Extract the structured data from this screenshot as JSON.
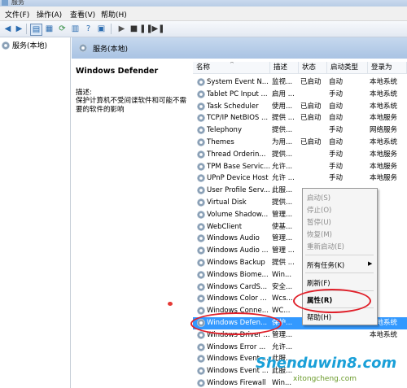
{
  "window": {
    "title": "服务"
  },
  "menu": [
    "文件(F)",
    "操作(A)",
    "查看(V)",
    "帮助(H)"
  ],
  "tree": {
    "root": "服务(本地)"
  },
  "band": {
    "label": "服务(本地)"
  },
  "detail": {
    "service_name": "Windows Defender",
    "desc_label": "描述:",
    "desc_text": "保护计算机不受间谍软件和可能不需要的软件的影响"
  },
  "columns": [
    "名称",
    "描述",
    "状态",
    "启动类型",
    "登录为"
  ],
  "rows": [
    {
      "name": "System Event N...",
      "desc": "监视...",
      "status": "已启动",
      "startup": "自动",
      "logon": "本地系统"
    },
    {
      "name": "Tablet PC Input ...",
      "desc": "启用 ...",
      "status": "",
      "startup": "手动",
      "logon": "本地系统"
    },
    {
      "name": "Task Scheduler",
      "desc": "使用...",
      "status": "已启动",
      "startup": "自动",
      "logon": "本地系统"
    },
    {
      "name": "TCP/IP NetBIOS ...",
      "desc": "提供 ...",
      "status": "已启动",
      "startup": "自动",
      "logon": "本地服务"
    },
    {
      "name": "Telephony",
      "desc": "提供...",
      "status": "",
      "startup": "手动",
      "logon": "网络服务"
    },
    {
      "name": "Themes",
      "desc": "为用...",
      "status": "已启动",
      "startup": "自动",
      "logon": "本地系统"
    },
    {
      "name": "Thread Orderin...",
      "desc": "提供...",
      "status": "",
      "startup": "手动",
      "logon": "本地服务"
    },
    {
      "name": "TPM Base Servic...",
      "desc": "允许...",
      "status": "",
      "startup": "手动",
      "logon": "本地服务"
    },
    {
      "name": "UPnP Device Host",
      "desc": "允许 ...",
      "status": "",
      "startup": "手动",
      "logon": "本地服务"
    },
    {
      "name": "User Profile Serv...",
      "desc": "此服...",
      "status": "",
      "startup": "",
      "logon": ""
    },
    {
      "name": "Virtual Disk",
      "desc": "提供...",
      "status": "",
      "startup": "",
      "logon": ""
    },
    {
      "name": "Volume Shadow...",
      "desc": "管理...",
      "status": "",
      "startup": "",
      "logon": ""
    },
    {
      "name": "WebClient",
      "desc": "使基...",
      "status": "",
      "startup": "",
      "logon": ""
    },
    {
      "name": "Windows Audio",
      "desc": "管理...",
      "status": "",
      "startup": "",
      "logon": ""
    },
    {
      "name": "Windows Audio ...",
      "desc": "管理 ...",
      "status": "",
      "startup": "",
      "logon": ""
    },
    {
      "name": "Windows Backup",
      "desc": "提供 ...",
      "status": "",
      "startup": "",
      "logon": ""
    },
    {
      "name": "Windows Biome...",
      "desc": "Win...",
      "status": "",
      "startup": "",
      "logon": ""
    },
    {
      "name": "Windows CardS...",
      "desc": "安全...",
      "status": "",
      "startup": "",
      "logon": ""
    },
    {
      "name": "Windows Color ...",
      "desc": "Wcs...",
      "status": "",
      "startup": "",
      "logon": ""
    },
    {
      "name": "Windows Conne...",
      "desc": "WC...",
      "status": "",
      "startup": "",
      "logon": ""
    },
    {
      "name": "Windows Defen...",
      "desc": "保护...",
      "status": "",
      "startup": "",
      "logon": "本地系统"
    },
    {
      "name": "Windows Driver ...",
      "desc": "管理...",
      "status": "",
      "startup": "",
      "logon": "本地系统"
    },
    {
      "name": "Windows Error ...",
      "desc": "允许...",
      "status": "",
      "startup": "",
      "logon": ""
    },
    {
      "name": "Windows Event ...",
      "desc": "此服...",
      "status": "",
      "startup": "",
      "logon": ""
    },
    {
      "name": "Windows Event ...",
      "desc": "此服...",
      "status": "",
      "startup": "",
      "logon": ""
    },
    {
      "name": "Windows Firewall",
      "desc": "Win...",
      "status": "",
      "startup": "",
      "logon": ""
    }
  ],
  "context_menu": {
    "start": "启动(S)",
    "stop": "停止(O)",
    "pause": "暂停(U)",
    "resume": "恢复(M)",
    "restart": "重新启动(E)",
    "all_tasks": "所有任务(K)",
    "refresh": "刷新(F)",
    "properties": "属性(R)",
    "help": "帮助(H)"
  },
  "watermark": {
    "line1": "Shenduwin8.com",
    "line2": "xitongcheng.com"
  },
  "colors": {
    "selection": "#3399ff",
    "annotation": "#e0202a"
  }
}
